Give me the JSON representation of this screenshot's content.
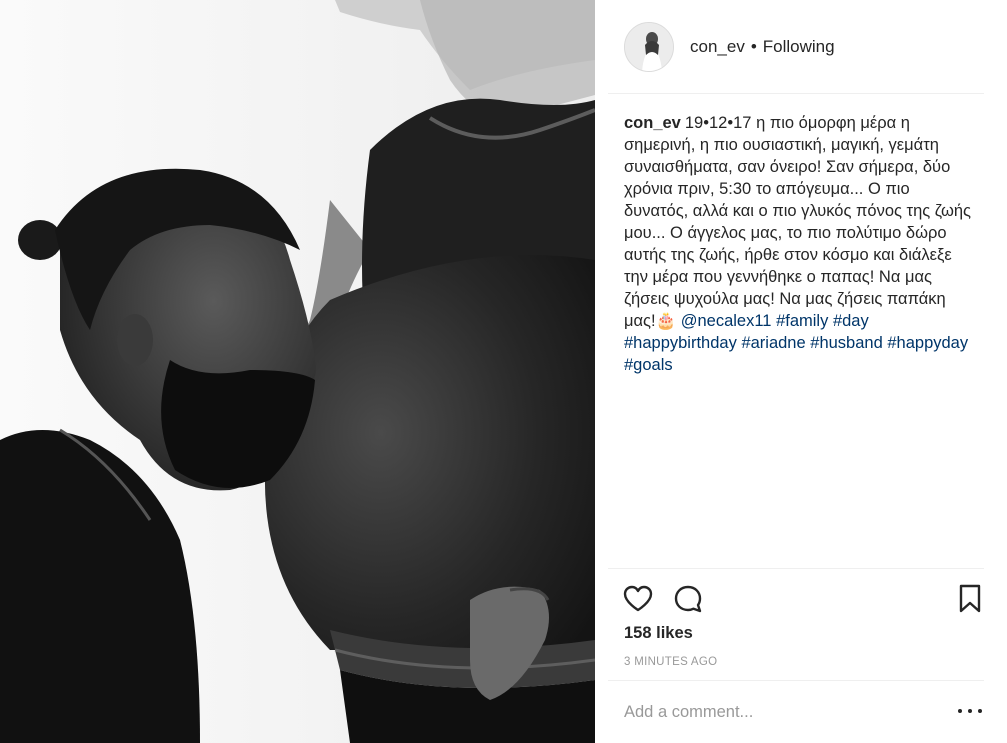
{
  "post": {
    "username": "con_ev",
    "separator": "•",
    "follow_state": "Following",
    "caption": {
      "username": "con_ev",
      "text": "19•12•17 η πιο όμορφη μέρα η σημερινή, η πιο ουσιαστική, μαγική, γεμάτη συναισθήματα, σαν όνειρο! Σαν σήμερα, δύο χρόνια πριν, 5:30 το απόγευμα... Ο πιο δυνατός, αλλά και ο πιο γλυκός πόνος της ζωής μου... Ο άγγελος μας, το πιο πολύτιμο δώρο αυτής της ζωής, ήρθε στον κόσμο και διάλεξε την μέρα που γεννήθηκε ο παπας! Να μας ζήσεις ψυχούλα μας! Να μας ζήσεις παπάκη μας!🎂",
      "mention": "@necalex11",
      "hashtags": [
        "#family",
        "#day",
        "#happybirthday",
        "#ariadne",
        "#husband",
        "#happyday",
        "#goals"
      ]
    },
    "likes": "158 likes",
    "time": "3 MINUTES AGO",
    "comment_placeholder": "Add a comment...",
    "icons": {
      "like": "heart-icon",
      "comment": "comment-icon",
      "save": "bookmark-icon",
      "more": "more-options-icon"
    },
    "colors": {
      "link": "#003569",
      "muted": "#999999",
      "text": "#262626",
      "divider": "#efefef"
    }
  }
}
